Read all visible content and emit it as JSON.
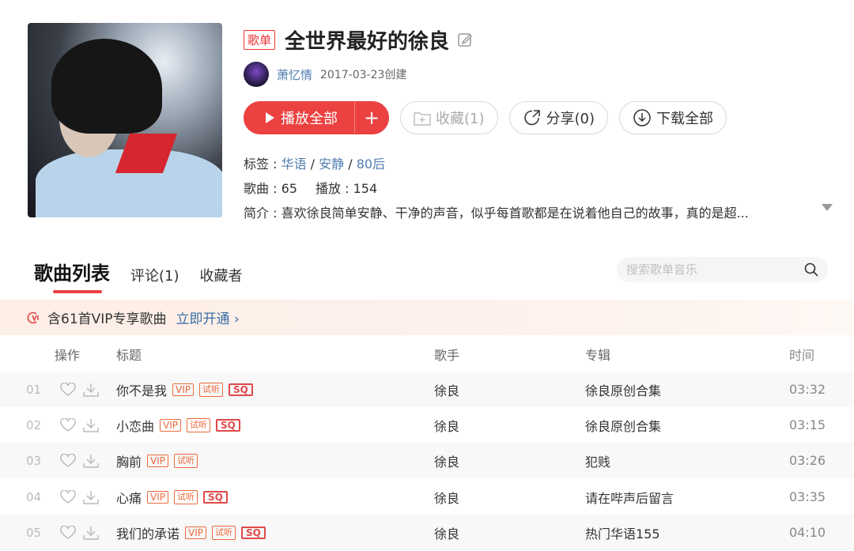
{
  "header": {
    "badge": "歌单",
    "title": "全世界最好的徐良",
    "creator": "萧忆情",
    "created": "2017-03-23创建"
  },
  "actions": {
    "play_all": "播放全部",
    "play_add": "+",
    "collect": "收藏(1)",
    "share": "分享(0)",
    "download": "下载全部"
  },
  "meta": {
    "tags_label": "标签 : ",
    "tags": [
      "华语",
      "安静",
      "80后"
    ],
    "tag_sep": " / ",
    "songs_label": "歌曲 : 65",
    "plays_label": "播放 : 154",
    "intro": "简介 : 喜欢徐良简单安静、干净的声音，似乎每首歌都是在说着他自己的故事，真的是超..."
  },
  "tabs": {
    "songs": "歌曲列表",
    "comments": "评论(1)",
    "collectors": "收藏者"
  },
  "search": {
    "placeholder": "搜索歌单音乐"
  },
  "vip_banner": {
    "text": "含61首VIP专享歌曲",
    "link": "立即开通 ›"
  },
  "table": {
    "headers": {
      "ops": "操作",
      "title": "标题",
      "artist": "歌手",
      "album": "专辑",
      "time": "时间"
    },
    "badges": {
      "vip": "VIP",
      "try": "试听",
      "sq": "SQ"
    },
    "rows": [
      {
        "idx": "01",
        "title": "你不是我",
        "vip": true,
        "try": true,
        "sq": true,
        "artist": "徐良",
        "album": "徐良原创合集",
        "time": "03:32"
      },
      {
        "idx": "02",
        "title": "小恋曲",
        "vip": true,
        "try": true,
        "sq": true,
        "artist": "徐良",
        "album": "徐良原创合集",
        "time": "03:15"
      },
      {
        "idx": "03",
        "title": "胸前",
        "vip": true,
        "try": true,
        "sq": false,
        "artist": "徐良",
        "album": "犯贱",
        "time": "03:26"
      },
      {
        "idx": "04",
        "title": "心痛",
        "vip": true,
        "try": true,
        "sq": true,
        "artist": "徐良",
        "album": "请在哔声后留言",
        "time": "03:35"
      },
      {
        "idx": "05",
        "title": "我们的承诺",
        "vip": true,
        "try": true,
        "sq": true,
        "artist": "徐良",
        "album": "热门华语155",
        "time": "04:10"
      }
    ]
  },
  "colors": {
    "accent": "#ec4141",
    "link": "#507daf"
  }
}
